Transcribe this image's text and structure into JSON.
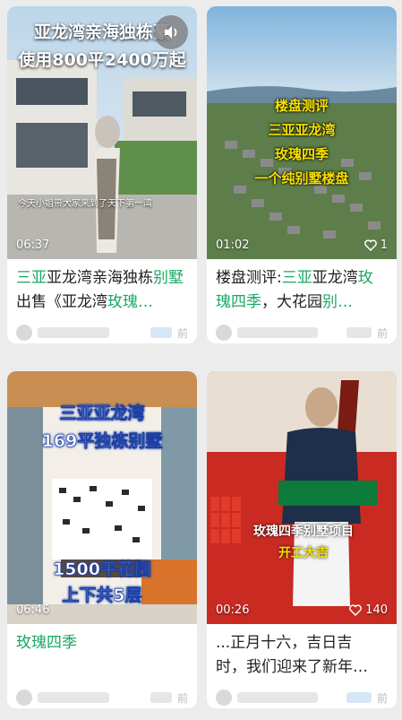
{
  "cards": [
    {
      "overlay_title_1": "亚龙湾亲海独栋豪",
      "overlay_title_2": "使用800平2400万起",
      "subtitle": "今天小姐带大家来到了天下第一湾",
      "duration": "06:37",
      "title_green_1": "三亚",
      "title_plain_1": "亚龙湾亲海独栋",
      "title_green_2": "别墅",
      "title_plain_2": "出售《亚龙湾",
      "title_green_3": "玫瑰…",
      "time": "前"
    },
    {
      "overlay_lines": [
        "楼盘测评",
        "三亚亚龙湾",
        "玫瑰四季",
        "一个纯别墅楼盘"
      ],
      "duration": "01:02",
      "likes": "1",
      "title_plain_1": "楼盘测评:",
      "title_green_1": "三亚",
      "title_plain_2": "亚龙湾",
      "title_green_2": "玫瑰四季",
      "title_plain_3": "，大花园",
      "title_green_3": "别…",
      "time": "前"
    },
    {
      "overlay_lines": [
        "三亚亚龙湾",
        "169平独栋别墅"
      ],
      "overlay_bottom": [
        "1500平花园",
        "上下共5层"
      ],
      "duration": "06:46",
      "title_green_1": "玫瑰四季",
      "time": "前"
    },
    {
      "banner_red": "玫瑰四季别墅项目",
      "banner_yellow": "开工大吉",
      "duration": "00:26",
      "likes": "140",
      "title_line_1": "...正月十六，吉日吉",
      "title_line_2": "时，我们迎来了新年…",
      "time": "前"
    }
  ],
  "colors": {
    "green": "#1aa865",
    "banner_red": "#d7261e"
  },
  "icons": {
    "volume": "speaker-icon",
    "heart": "heart-icon"
  }
}
